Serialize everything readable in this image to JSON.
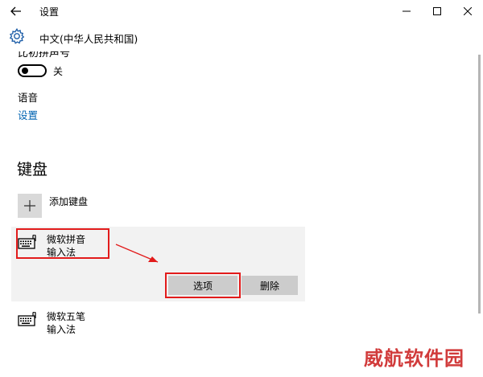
{
  "window": {
    "app_title": "设置",
    "back_icon": "back-arrow-icon",
    "controls": {
      "minimize": "—",
      "maximize": "☐",
      "close": "✕"
    }
  },
  "header": {
    "page_title": "中文(中华人民共和国)",
    "icon": "gear-icon"
  },
  "content": {
    "clipped_label": "比初拼声号",
    "toggle": {
      "state_label": "关",
      "on": false
    },
    "speech_section": {
      "label": "语音",
      "link": "设置"
    },
    "keyboard_heading": "键盘",
    "add_keyboard": {
      "icon": "plus-icon",
      "label": "添加键盘"
    },
    "keyboards": [
      {
        "name_line1": "微软拼音",
        "name_line2": "输入法",
        "icon": "keyboard-icon"
      },
      {
        "name_line1": "微软五笔",
        "name_line2": "输入法",
        "icon": "keyboard-icon"
      }
    ],
    "buttons": {
      "options": "选项",
      "remove": "删除"
    }
  },
  "watermark": "威航软件园",
  "colors": {
    "link": "#0063b1",
    "highlight": "#e21b1b",
    "button_bg": "#cccccc",
    "card_bg": "#f2f2f2"
  }
}
